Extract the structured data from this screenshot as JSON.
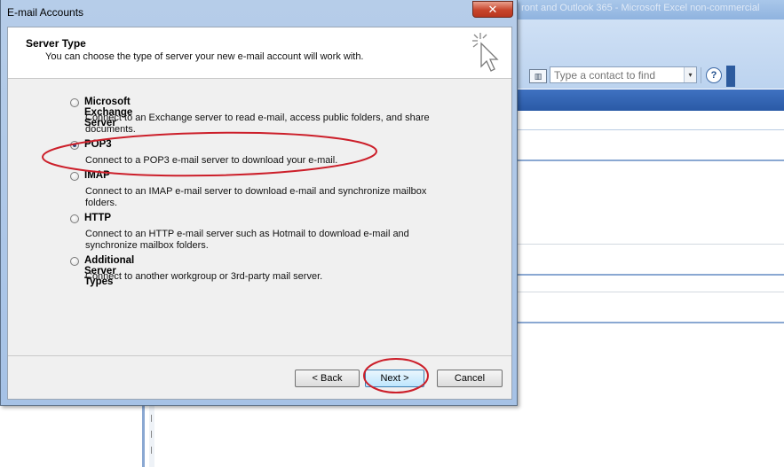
{
  "background": {
    "title_text": "ront and Outlook 365 - Microsoft Excel non-commercial",
    "contact_search": {
      "placeholder": "Type a contact to find"
    },
    "help_icon": "?",
    "dropdown_icon": "▾",
    "address_book_icon": "book-icon"
  },
  "dialog": {
    "title": "E-mail Accounts",
    "close_label": "✕",
    "header": {
      "title": "Server Type",
      "subtitle": "You can choose the type of server your new e-mail account will work with."
    },
    "options": [
      {
        "label": "Microsoft Exchange Server",
        "description": "Connect to an Exchange server to read e-mail, access public folders, and share documents.",
        "selected": false
      },
      {
        "label": "POP3",
        "description": "Connect to a POP3 e-mail server to download your e-mail.",
        "selected": true
      },
      {
        "label": "IMAP",
        "description": "Connect to an IMAP e-mail server to download e-mail and synchronize mailbox folders.",
        "selected": false
      },
      {
        "label": "HTTP",
        "description": "Connect to an HTTP e-mail server such as Hotmail to download e-mail and synchronize mailbox folders.",
        "selected": false
      },
      {
        "label": "Additional Server Types",
        "description": "Connect to another workgroup or 3rd-party mail server.",
        "selected": false
      }
    ],
    "buttons": {
      "back": "< Back",
      "next": "Next >",
      "cancel": "Cancel"
    }
  },
  "colors": {
    "annotation": "#cc1f2a",
    "dialog_frame": "#a6c2e6",
    "nav_band": "#2a5aa6"
  }
}
